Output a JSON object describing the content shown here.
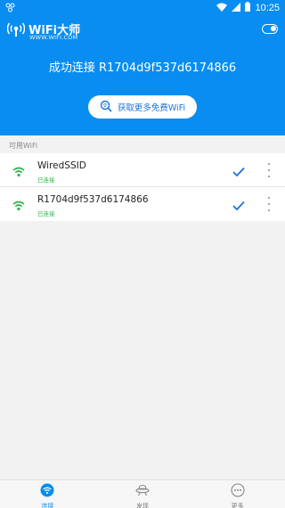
{
  "status_bar": {
    "time": "10:25",
    "left_icon": "signal-hd-icon"
  },
  "header": {
    "app_title": "WiFi大师",
    "app_url": "WWW.WIFI.COM",
    "connected_text": "成功连接 R1704d9f537d6174866",
    "get_more_label": "获取更多免费WiFi"
  },
  "list": {
    "section_label": "可用WiFi",
    "items": [
      {
        "ssid": "WiredSSID",
        "status": "已连接"
      },
      {
        "ssid": "R1704d9f537d6174866",
        "status": "已连接"
      }
    ]
  },
  "bottom_nav": {
    "items": [
      {
        "label": "连接",
        "icon": "wifi-icon",
        "active": true
      },
      {
        "label": "发现",
        "icon": "discover-icon",
        "active": false
      },
      {
        "label": "更多",
        "icon": "more-icon",
        "active": false
      }
    ]
  },
  "colors": {
    "primary": "#0a8df0",
    "connected_green": "#2db34a",
    "check_blue": "#1a73d9"
  }
}
